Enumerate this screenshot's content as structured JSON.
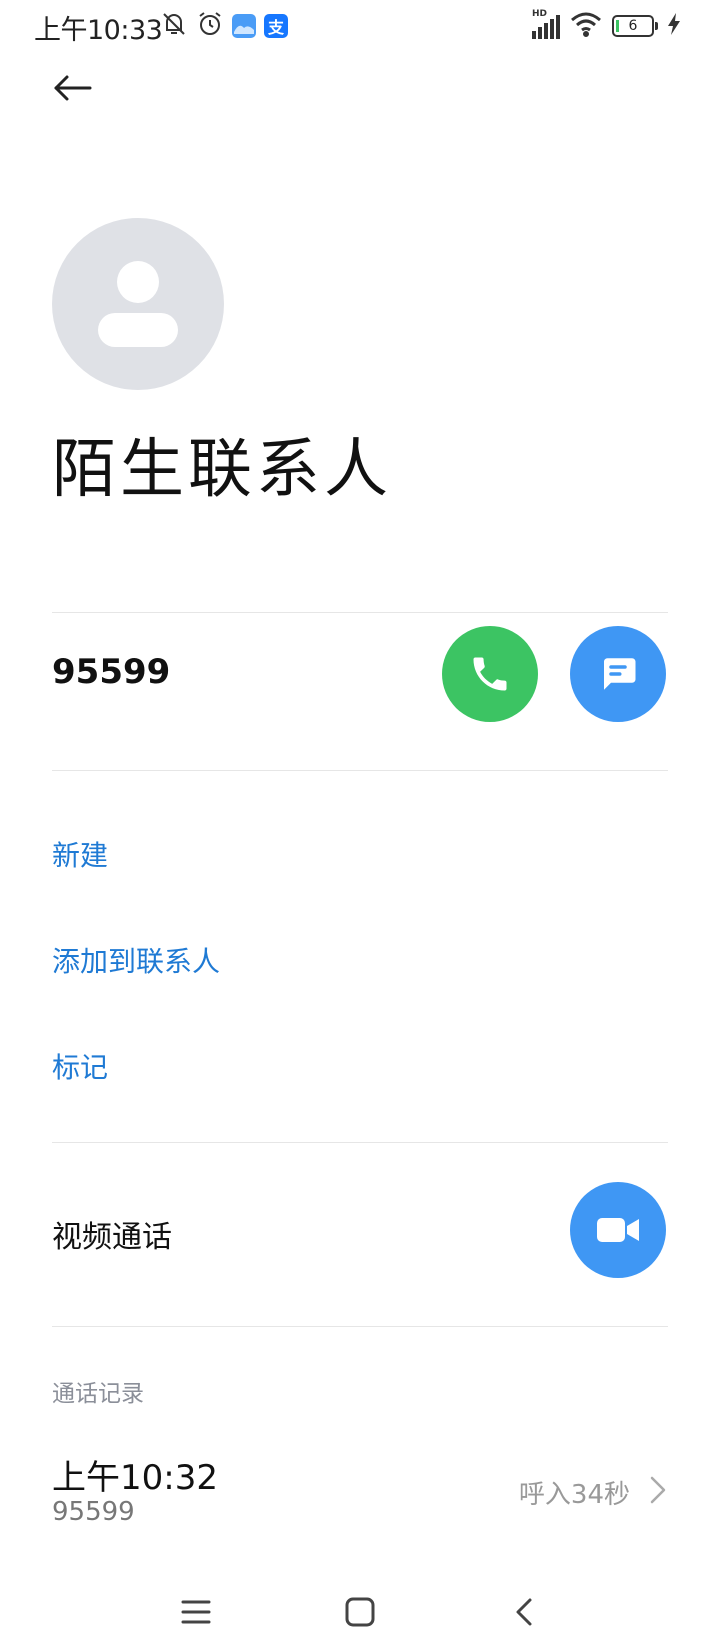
{
  "status_bar": {
    "time": "上午10:33",
    "left_icons": [
      "bell-off-icon",
      "alarm-icon",
      "gallery-app-icon",
      "alipay-app-icon"
    ],
    "alipay_glyph": "支",
    "right_icons": [
      "hd-signal-icon",
      "wifi-icon",
      "battery-icon",
      "charging-icon"
    ],
    "signal_label": "HD",
    "battery_level": "6",
    "colors": {
      "gallery": "#4a9cf6",
      "alipay": "#1677ff"
    }
  },
  "contact": {
    "name": "陌生联系人",
    "number": "95599"
  },
  "actions": {
    "new": "新建",
    "add_to_contacts": "添加到联系人",
    "mark": "标记"
  },
  "video_call": {
    "label": "视频通话"
  },
  "call_log": {
    "title": "通话记录",
    "entries": [
      {
        "time": "上午10:32",
        "number": "95599",
        "status": "呼入34秒"
      }
    ]
  },
  "colors": {
    "call_green": "#3cc463",
    "action_blue": "#3f97f4",
    "link_blue": "#1f7ad4"
  }
}
